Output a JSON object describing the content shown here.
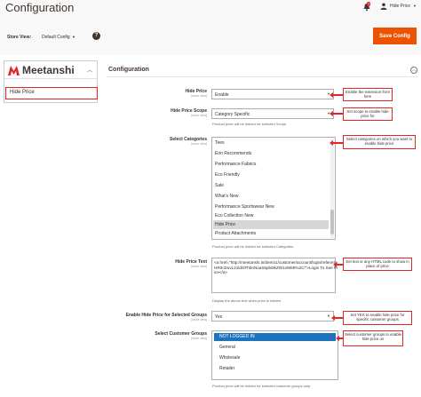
{
  "header": {
    "title": "Configuration",
    "notifications_count": "7",
    "user_name": "Hide Price",
    "store_view_label": "Store View:",
    "store_view_value": "Default Config",
    "save_label": "Save Config"
  },
  "sidebar": {
    "brand": "Meetanshi",
    "item_label": "Hide Price"
  },
  "section": {
    "title": "Configuration"
  },
  "fields": {
    "hide_price": {
      "label": "Hide Price",
      "scope": "[store view]",
      "value": "Enable"
    },
    "hide_price_scope": {
      "label": "Hide Price Scope",
      "scope": "[store view]",
      "value": "Category Specific",
      "note": "Product price will be hidden for selected Scope"
    },
    "categories": {
      "label": "Select Categories",
      "scope": "[store view]",
      "options": [
        "Tees",
        "Erin Recommends",
        "Performance Fabrics",
        "Eco Friendly",
        "Sale",
        "What's New",
        "Performance Sportswear New",
        "Eco Collection New",
        "Hide Price",
        "Product Attachments"
      ],
      "selected": "Hide Price",
      "note": "Product price will be hidden for selected Categories."
    },
    "hide_price_text": {
      "label": "Hide Price Text",
      "scope": "[store view]",
      "value": "<a href=\"http://meetanshi.in/demo1/customer/account/login/referer/aHR0cDovL21ldGFhbnNoaS5pbi9kZW1vMS8%2C/\">Login To See Price</a>",
      "note": "Display the above text when price is hidden."
    },
    "enable_groups": {
      "label": "Enable Hide Price for Selected Groups",
      "scope": "[store view]",
      "value": "Yes"
    },
    "customer_groups": {
      "label": "Select Customer Groups",
      "scope": "[store view]",
      "options": [
        "NOT LOGGED IN",
        "General",
        "Wholesale",
        "Retailer"
      ],
      "selected": "NOT LOGGED IN",
      "note": "Product price will be hidden for selected customer groups only."
    }
  },
  "callouts": {
    "enable": "Enable the extension from here",
    "scope": "Set scope to enable hide price for",
    "categories": "Select categories on which you want to enable hide price",
    "text": "Set text or any HTML code to show in place of price",
    "groups_enable": "Set YES to enable hide price for specific customer groups",
    "groups_select": "Select customer groups to enable hide price on"
  },
  "colors": {
    "accent": "#eb5202",
    "callout_border": "#e22626",
    "selected_group": "#1e73be"
  }
}
